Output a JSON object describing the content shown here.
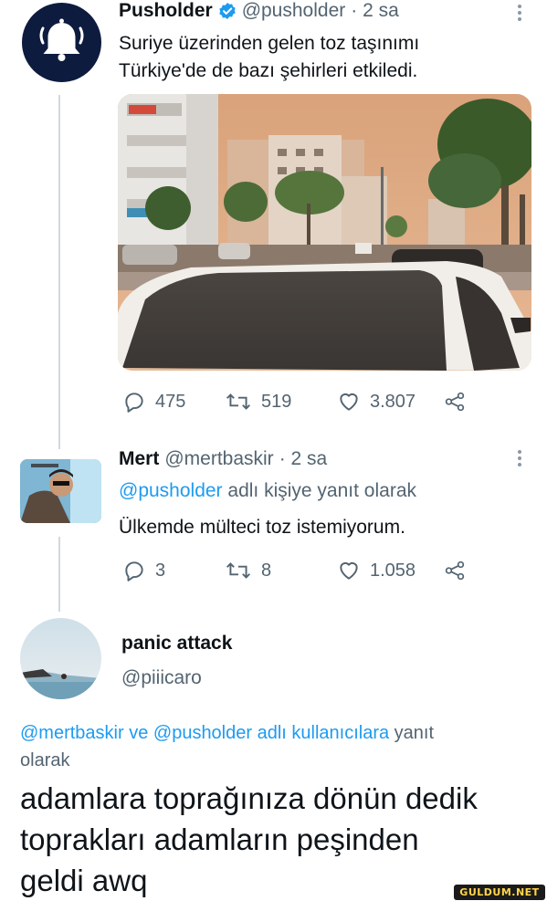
{
  "tweet1": {
    "name": "Pusholder",
    "handle": "@pusholder",
    "time": "· 2 sa",
    "text_line1": "Suriye üzerinden gelen toz taşınımı",
    "text_line2": "Türkiye'de de bazı şehirleri etkiledi.",
    "replies": "475",
    "retweets": "519",
    "likes": "3.807"
  },
  "tweet2": {
    "name": "Mert",
    "handle": "@mertbaskir",
    "time": "· 2 sa",
    "reply_mention": "@pusholder",
    "reply_suffix": " adlı kişiye yanıt olarak",
    "text": "Ülkemde mülteci toz istemiyorum.",
    "replies": "3",
    "retweets": "8",
    "likes": "1.058"
  },
  "tweet3": {
    "name": "panic attack",
    "handle": "@piiicaro",
    "reply_links": "@mertbaskir ve @pusholder adlı kullanıcılara",
    "reply_suffix": " yanıt",
    "reply_line2": "olarak",
    "text_line1": "adamlara toprağınıza dönün dedik",
    "text_line2": "toprakları adamların peşinden",
    "text_line3": "geldi awq"
  },
  "watermark": "GULDUM.NET",
  "colors": {
    "link": "#1d9bf0",
    "verified": "#1d9bf0",
    "muted": "#536471"
  }
}
